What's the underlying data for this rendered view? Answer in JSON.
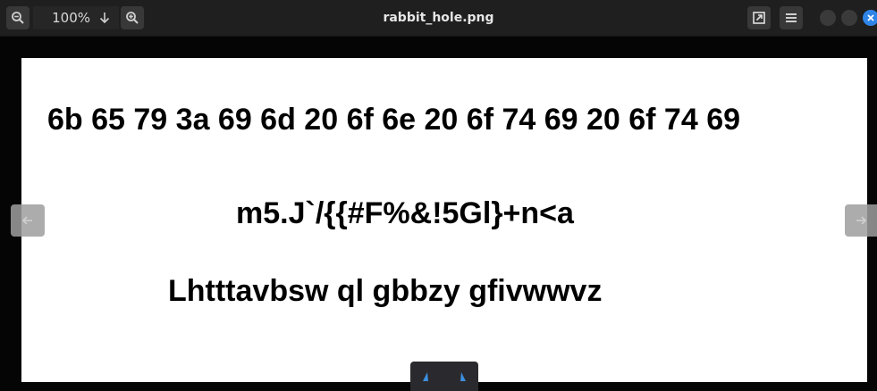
{
  "titlebar": {
    "title": "rabbit_hole.png",
    "zoom_value": "100%"
  },
  "image_text": {
    "line1": "6b 65 79 3a 69 6d 20 6f 6e 20 6f 74 69 20 6f 74 69",
    "line2": "m5.J`/{{#F%&!5Gl}+n<a",
    "line3": "Lhtttavbsw ql gbbzy gfivwwvz"
  },
  "colors": {
    "titlebar_bg": "#1f1f1f",
    "canvas_bg": "#ffffff",
    "accent_close": "#2f84e8",
    "text": "#000000"
  },
  "icons": {
    "zoom_out": "zoom-out-icon",
    "zoom_in": "zoom-in-icon",
    "zoom_menu": "arrow-down-icon",
    "fullscreen": "expand-icon",
    "menu": "hamburger-menu-icon",
    "close": "close-icon",
    "prev": "arrow-left-icon",
    "next": "arrow-right-icon"
  }
}
